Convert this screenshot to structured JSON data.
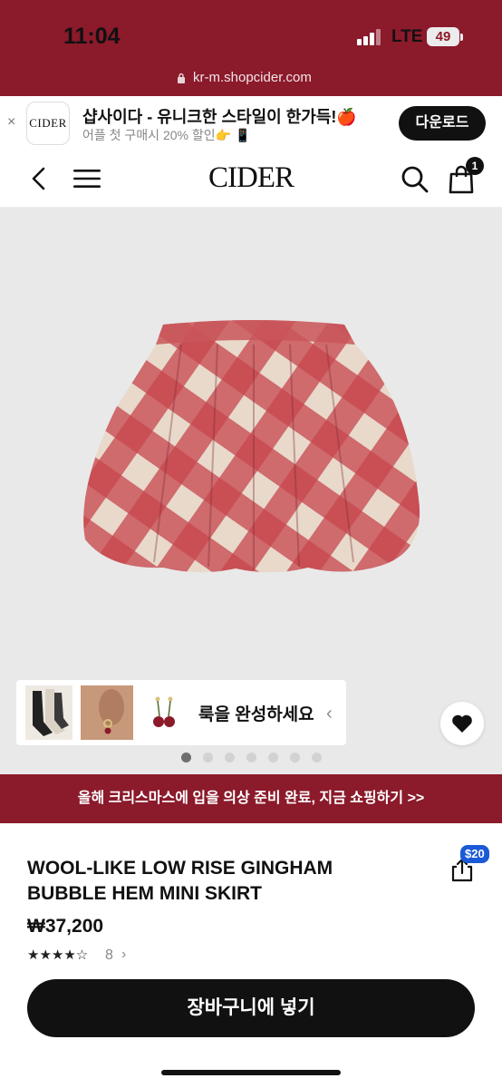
{
  "status_bar": {
    "time": "11:04",
    "network": "LTE",
    "battery": "49"
  },
  "browser": {
    "url": "kr-m.shopcider.com"
  },
  "app_banner": {
    "close": "×",
    "app_icon_label": "CIDER",
    "title": "샵사이다 - 유니크한 스타일이 한가득!🍎",
    "subtitle": "어플 첫 구매시 20% 할인👉 📱",
    "download_label": "다운로드"
  },
  "nav": {
    "logo": "CIDER",
    "cart_count": "1"
  },
  "gallery": {
    "look_text": "룩을 완성하세요",
    "look_arrow": "‹",
    "dot_count": 7,
    "active_dot": 0
  },
  "promo": {
    "text": "올해 크리스마스에 입을 의상 준비 완료, 지금 쇼핑하기 >>"
  },
  "product": {
    "title": "WOOL-LIKE LOW RISE GINGHAM BUBBLE HEM MINI SKIRT",
    "price": "₩37,200",
    "rating": 3.5,
    "stars": "★★★★☆",
    "review_count": "8",
    "review_arrow": "›",
    "coupon": "$20"
  },
  "cart": {
    "label": "장바구니에 넣기"
  },
  "colors": {
    "brand": "#8b1a2b",
    "black": "#111111",
    "coupon_blue": "#1a5ad6"
  }
}
